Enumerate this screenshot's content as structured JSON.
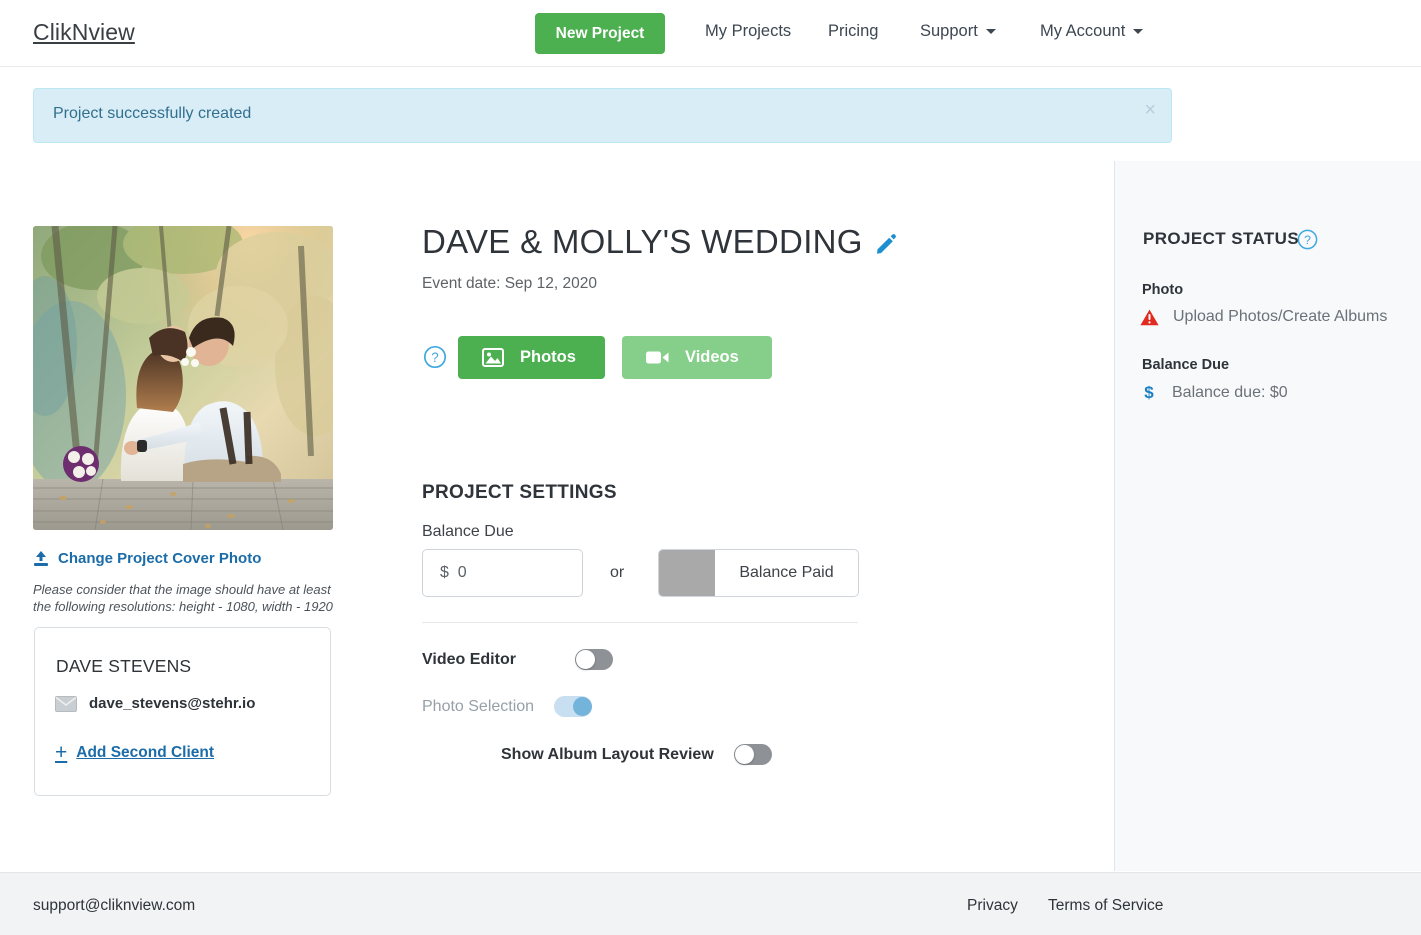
{
  "navbar": {
    "logo": "ClikNview",
    "new_project_label": "New Project",
    "links": [
      {
        "label": "My Projects",
        "caret": false
      },
      {
        "label": "Pricing",
        "caret": false
      },
      {
        "label": "Support",
        "caret": true
      },
      {
        "label": "My Account",
        "caret": true
      }
    ],
    "accent_green": "#4caf50"
  },
  "alert": {
    "message": "Project successfully created",
    "close_label": "×",
    "bg": "#d9edf7",
    "text_color": "#31708f"
  },
  "cover": {
    "image_alt": "Wedding couple sitting on wooden dock",
    "change_link": "Change Project Cover Photo",
    "upload_icon": "upload-icon",
    "note": "Please consider that the image should have at least the following resolutions: height - 1080, width - 1920"
  },
  "client": {
    "name": "DAVE STEVENS",
    "email": "dave_stevens@stehr.io",
    "email_icon": "envelope-icon",
    "add_second_label": "Add Second Client",
    "plus_icon": "plus-icon",
    "link_color": "#1b6ca8"
  },
  "project": {
    "title": "DAVE & MOLLY'S WEDDING",
    "edit_icon": "pencil-icon",
    "event_date": "Event date: Sep 12, 2020",
    "help_icon": "help-circle-icon",
    "photos_button": "Photos",
    "photos_icon": "image-icon",
    "videos_button": "Videos",
    "videos_icon": "video-camera-icon"
  },
  "settings": {
    "heading": "PROJECT SETTINGS",
    "balance_due_label": "Balance Due",
    "balance_value": "$  0",
    "balance_placeholder": "$  0",
    "or_text": "or",
    "balance_paid_label": "Balance Paid",
    "balance_paid_state": "off",
    "toggles": [
      {
        "label": "Video Editor",
        "state": "off",
        "muted": false
      },
      {
        "label": "Photo Selection",
        "state": "on",
        "muted": true
      },
      {
        "label": "Show Album Layout Review",
        "state": "off",
        "muted": false
      }
    ]
  },
  "sidebar": {
    "title": "PROJECT STATUS",
    "help_icon": "help-circle-icon",
    "groups": [
      {
        "label": "Photo",
        "icon": "warning-triangle-icon",
        "item_text": "Upload Photos/Create Albums"
      },
      {
        "label": "Balance Due",
        "icon": "dollar-icon",
        "item_text": "Balance due: $0"
      }
    ],
    "warning_color": "#e02b20",
    "dollar_color": "#1b7fc4",
    "bg": "#f7f9fa"
  },
  "footer": {
    "support_email": "support@cliknview.com",
    "privacy": "Privacy",
    "terms": "Terms of Service"
  }
}
